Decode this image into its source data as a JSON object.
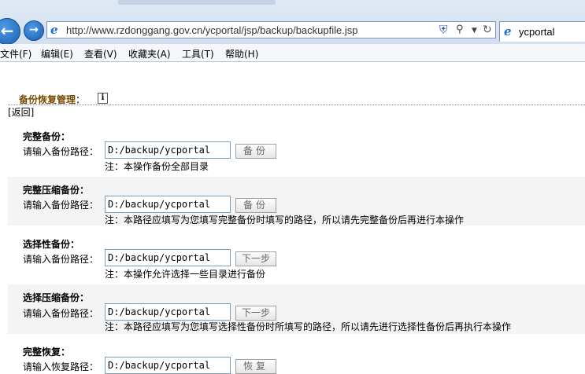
{
  "browser": {
    "url": "http://www.rzdonggang.gov.cn/ycportal/jsp/backup/backupfile.jsp",
    "tab_title": "ycportal",
    "menu": [
      "文件(F)",
      "编辑(E)",
      "查看(V)",
      "收藏夹(A)",
      "工具(T)",
      "帮助(H)"
    ]
  },
  "page": {
    "title": "备份恢复管理：",
    "back_link": "[返回]"
  },
  "sections": [
    {
      "heading": "完整备份：",
      "label": "请输入备份路径：",
      "value": "D:/backup/ycportal",
      "button": "备份",
      "note": "注：本操作备份全部目录"
    },
    {
      "heading": "完整压缩备份：",
      "label": "请输入备份路径：",
      "value": "D:/backup/ycportal",
      "button": "备份",
      "note": "注：本路径应填写为您填写完整备份时填写的路径，所以请先完整备份后再进行本操作"
    },
    {
      "heading": "选择性备份：",
      "label": "请输入备份路径：",
      "value": "D:/backup/ycportal",
      "button": "下一步",
      "note": "注：本操作允许选择一些目录进行备份"
    },
    {
      "heading": "选择压缩备份：",
      "label": "请输入备份路径：",
      "value": "D:/backup/ycportal",
      "button": "下一步",
      "note": "注：本路径应填写为您填写选择性备份时所填写的路径，所以请先进行选择性备份后再执行本操作"
    },
    {
      "heading": "完整恢复：",
      "label": "请输入恢复路径：",
      "value": "D:/backup/ycportal",
      "button": "恢复",
      "note": ""
    }
  ]
}
